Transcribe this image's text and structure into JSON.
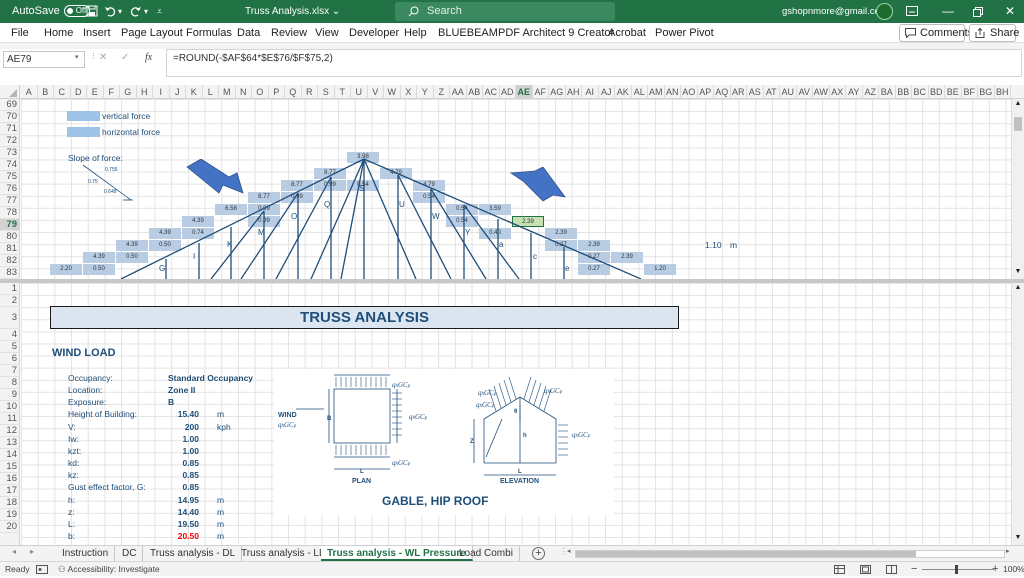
{
  "titlebar": {
    "autosave_label": "AutoSave",
    "autosave_state": "Off",
    "file_name": "Truss Analysis.xlsx",
    "search_placeholder": "Search",
    "account": "gshopnmore@gmail.com"
  },
  "menu": {
    "items": [
      "File",
      "Home",
      "Insert",
      "Page Layout",
      "Formulas",
      "Data",
      "Review",
      "View",
      "Developer",
      "Help",
      "BLUEBEAM",
      "PDF Architect 9 Creator",
      "Acrobat",
      "Power Pivot"
    ],
    "comments": "Comments",
    "share": "Share"
  },
  "formula": {
    "name_box": "AE79",
    "fx": "fx",
    "content": "=ROUND(-$AF$64*$E$76/$F$75,2)"
  },
  "columns": [
    "A",
    "B",
    "C",
    "D",
    "E",
    "F",
    "G",
    "H",
    "I",
    "J",
    "K",
    "L",
    "M",
    "N",
    "O",
    "P",
    "Q",
    "R",
    "S",
    "T",
    "U",
    "V",
    "W",
    "X",
    "Y",
    "Z",
    "AA",
    "AB",
    "AC",
    "AD",
    "AE",
    "AF",
    "AG",
    "AH",
    "AI",
    "AJ",
    "AK",
    "AL",
    "AM",
    "AN",
    "AO",
    "AP",
    "AQ",
    "AR",
    "AS",
    "AT",
    "AU",
    "AV",
    "AW",
    "AX",
    "AY",
    "AZ",
    "BA",
    "BB",
    "BC",
    "BD",
    "BE",
    "BF",
    "BG",
    "BH"
  ],
  "top_pane": {
    "rows": [
      "69",
      "70",
      "71",
      "72",
      "73",
      "74",
      "75",
      "76",
      "77",
      "78",
      "79",
      "80",
      "81",
      "82",
      "83"
    ],
    "legend_vertical": "vertical force",
    "legend_horizontal": "horizontal force",
    "slope_label": "Slope of force:",
    "slope_a": "0.755",
    "slope_b": "0.75",
    "slope_c": "0.648",
    "values": [
      "3.98",
      "8.77",
      "4.79",
      "0.99",
      "0.54",
      "8.77",
      "4.79",
      "8.77",
      "0.99",
      "0.54",
      "6.58",
      "0.99",
      "3.59",
      "0.54",
      "4.39",
      "0.99",
      "0.54",
      "2.39",
      "4.39",
      "0.74",
      "0.40",
      "2.39",
      "4.39",
      "0.50",
      "0.27",
      "2.39",
      "4.39",
      "0.50",
      "0.27",
      "2.39",
      "2.20",
      "0.50",
      "0.27",
      "1.20"
    ],
    "nodes": [
      "S",
      "Q",
      "U",
      "O",
      "W",
      "M",
      "Y",
      "K",
      "a",
      "I",
      "c",
      "G",
      "e"
    ],
    "side_value": "1.10",
    "side_unit": "m"
  },
  "bottom_pane": {
    "rows": [
      "1",
      "2",
      "3",
      "4",
      "5",
      "6",
      "7",
      "8",
      "9",
      "10",
      "11",
      "12",
      "13",
      "14",
      "15",
      "16",
      "17",
      "18",
      "19",
      "20"
    ],
    "title": "TRUSS ANALYSIS",
    "section": "WIND LOAD",
    "fields": [
      {
        "label": "Occupancy:",
        "value": "Standard Occupancy",
        "unit": ""
      },
      {
        "label": "Location:",
        "value": "Zone II",
        "unit": ""
      },
      {
        "label": "Exposure:",
        "value": "B",
        "unit": ""
      },
      {
        "label": "Height of Building:",
        "value": "15.40",
        "unit": "m"
      },
      {
        "label": "V:",
        "value": "200",
        "unit": "kph"
      },
      {
        "label": "Iw:",
        "value": "1.00",
        "unit": ""
      },
      {
        "label": "kzt:",
        "value": "1.00",
        "unit": ""
      },
      {
        "label": "kd:",
        "value": "0.85",
        "unit": ""
      },
      {
        "label": "kz:",
        "value": "0.85",
        "unit": ""
      },
      {
        "label": "Gust effect factor, G:",
        "value": "0.85",
        "unit": ""
      },
      {
        "label": "h:",
        "value": "14.95",
        "unit": "m"
      },
      {
        "label": "z:",
        "value": "14.40",
        "unit": "m"
      },
      {
        "label": "L:",
        "value": "19.50",
        "unit": "m"
      },
      {
        "label": "b:",
        "value": "20.50",
        "unit": "m"
      }
    ],
    "figure": {
      "wind": "WIND",
      "qhgcp_left": "qₕGCₚ",
      "qhgcp": "qₕGCₚ",
      "b": "B",
      "l": "L",
      "plan": "PLAN",
      "elevation": "ELEVATION",
      "z": "Z",
      "h": "h",
      "theta": "θ",
      "caption": "GABLE, HIP ROOF"
    }
  },
  "tabs": [
    "Instruction",
    "DC",
    "Truss analysis - DL",
    "Truss analysis - LL",
    "Truss analysis - WL Pressure",
    "Load Combi"
  ],
  "active_tab": "Truss analysis - WL Pressure",
  "status": {
    "ready": "Ready",
    "accessibility": "Accessibility: Investigate",
    "zoom": "100%"
  },
  "colors": {
    "excel_green": "#217346",
    "cell_fill": "#b8cce4",
    "title_fill": "#dce6f1",
    "label_blue": "#1f4e79",
    "arrow_blue": "#4472c4",
    "red_value": "#ff0000"
  }
}
